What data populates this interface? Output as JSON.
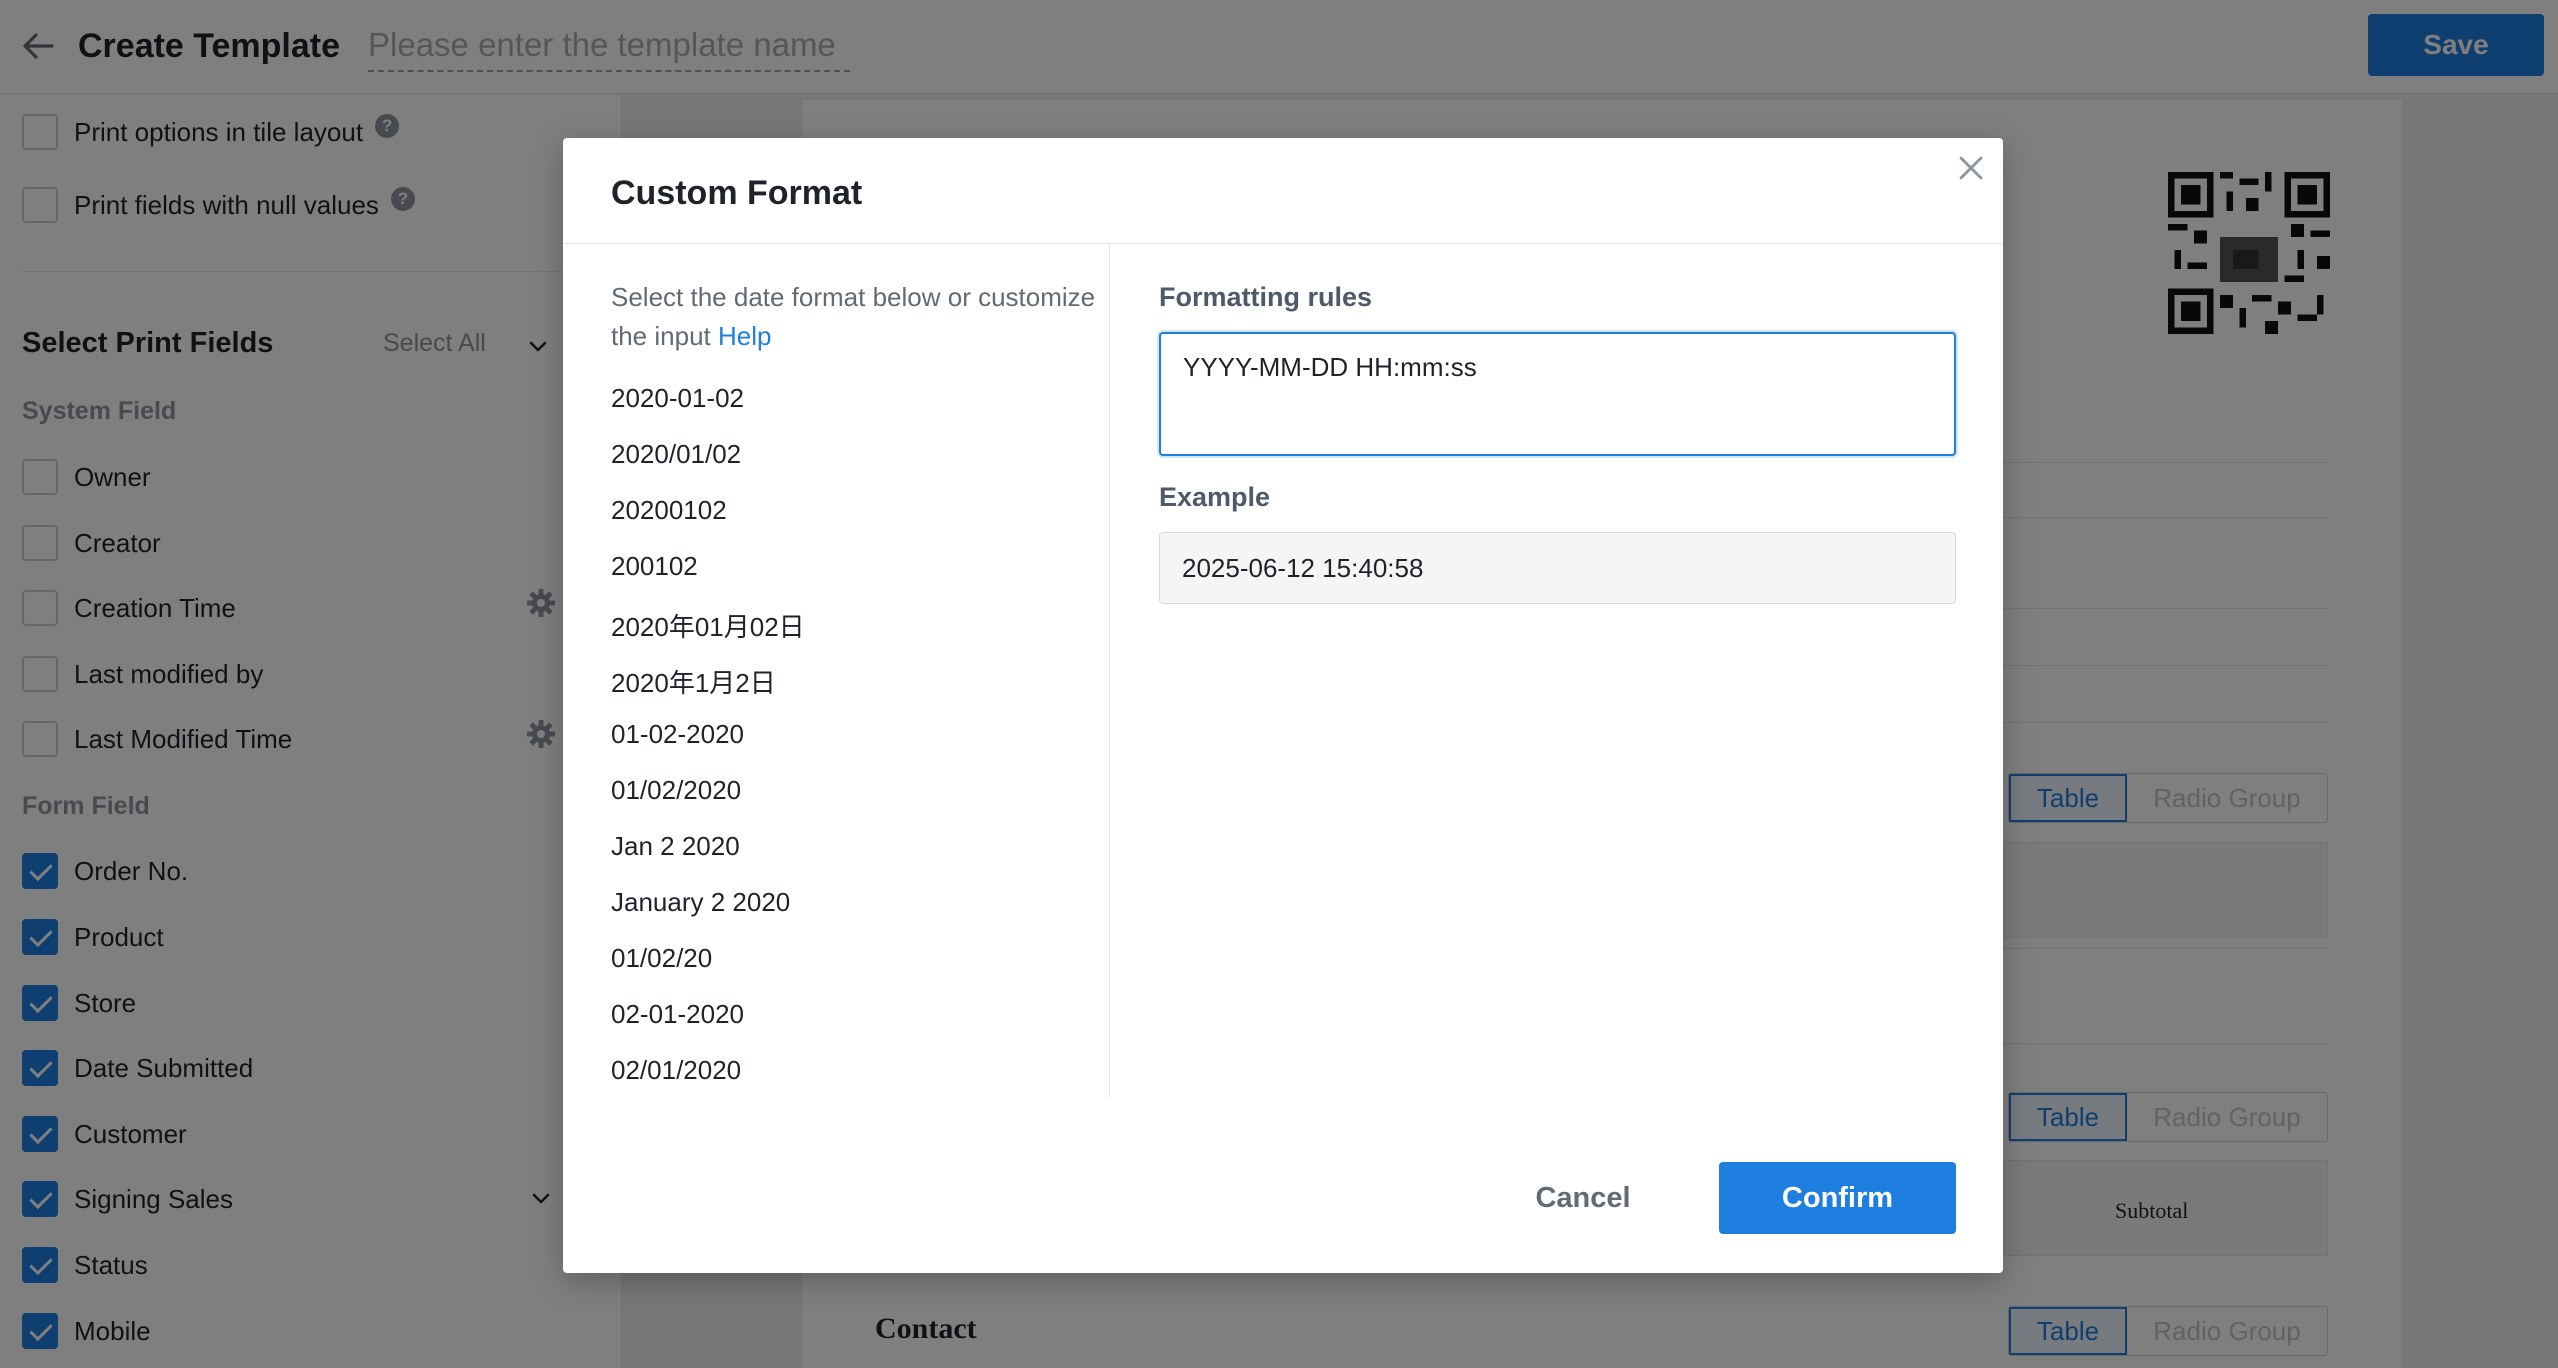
{
  "header": {
    "title": "Create Template",
    "name_placeholder": "Please enter the template name",
    "save_label": "Save"
  },
  "left_panel": {
    "options": [
      {
        "label": "Print options in tile layout",
        "checked": false
      },
      {
        "label": "Print fields with null values",
        "checked": false
      }
    ],
    "section_title": "Select Print Fields",
    "select_all": "Select All",
    "system_group": "System Field",
    "system_fields": [
      {
        "label": "Owner",
        "checked": false,
        "gear": false
      },
      {
        "label": "Creator",
        "checked": false,
        "gear": false
      },
      {
        "label": "Creation Time",
        "checked": false,
        "gear": true
      },
      {
        "label": "Last modified by",
        "checked": false,
        "gear": false
      },
      {
        "label": "Last Modified Time",
        "checked": false,
        "gear": true
      }
    ],
    "form_group": "Form Field",
    "form_fields": [
      {
        "label": "Order No.",
        "checked": true
      },
      {
        "label": "Product",
        "checked": true
      },
      {
        "label": "Store",
        "checked": true
      },
      {
        "label": "Date Submitted",
        "checked": true
      },
      {
        "label": "Customer",
        "checked": true
      },
      {
        "label": "Signing Sales",
        "checked": true
      },
      {
        "label": "Status",
        "checked": true
      },
      {
        "label": "Mobile",
        "checked": true
      }
    ]
  },
  "canvas": {
    "toggle_on": "Table",
    "toggle_off": "Radio Group",
    "subtotal": "Subtotal",
    "contact": "Contact"
  },
  "dialog": {
    "title": "Custom Format",
    "intro_text": "Select the date format below or customize the input",
    "help_link": "Help",
    "formats": [
      "2020-01-02",
      "2020/01/02",
      "20200102",
      "200102",
      "2020年01月02日",
      "2020年1月2日",
      "01-02-2020",
      "01/02/2020",
      "Jan 2 2020",
      "January 2 2020",
      "01/02/20",
      "02-01-2020",
      "02/01/2020"
    ],
    "rules_label": "Formatting rules",
    "rules_value": "YYYY-MM-DD HH:mm:ss",
    "example_label": "Example",
    "example_value": "2025-06-12 15:40:58",
    "cancel_label": "Cancel",
    "confirm_label": "Confirm"
  },
  "colors": {
    "accent": "#1f7fe0",
    "overlay": "rgba(0,0,0,0.5)"
  }
}
